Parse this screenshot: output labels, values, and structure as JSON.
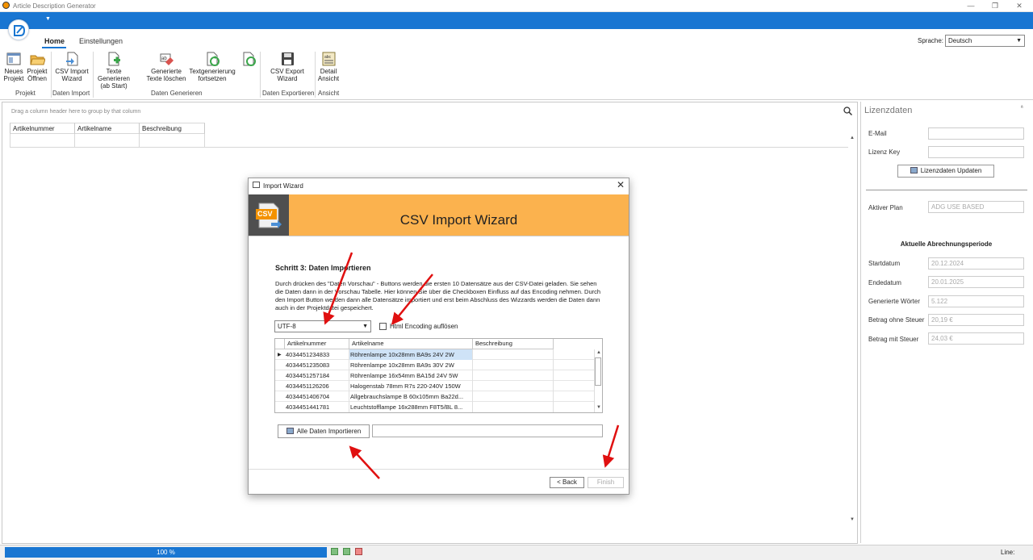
{
  "window": {
    "title": "Article Description Generator"
  },
  "ribbon": {
    "tabs": [
      "Home",
      "Einstellungen"
    ],
    "language_label": "Sprache:",
    "language_value": "Deutsch",
    "buttons": {
      "new_project": [
        "Neues",
        "Projekt"
      ],
      "open_project": [
        "Projekt",
        "Öffnen"
      ],
      "csv_import": [
        "CSV Import",
        "Wizard"
      ],
      "generate_texts": [
        "Texte Generieren",
        "(ab Start)"
      ],
      "delete_texts": [
        "Generierte",
        "Texte löschen"
      ],
      "continue_generation": [
        "Textgenerierung",
        "fortsetzen"
      ],
      "csv_export": [
        "CSV Export",
        "Wizard"
      ],
      "detail_view": [
        "Detail",
        "Ansicht"
      ]
    },
    "groups": [
      "Projekt",
      "Daten Import",
      "Daten Generieren",
      "Daten Exportieren",
      "Ansicht"
    ]
  },
  "grid": {
    "group_hint": "Drag a column header here to group by that column",
    "columns": [
      "Artikelnummer",
      "Artikelname",
      "Beschreibung"
    ]
  },
  "license_panel": {
    "title": "Lizenzdaten",
    "pin_symbol": "ª",
    "email_label": "E-Mail",
    "license_key_label": "Lizenz Key",
    "update_button": "Lizenzdaten Updaten",
    "plan_label": "Aktiver Plan",
    "plan_value": "ADG USE BASED",
    "billing_heading": "Aktuelle Abrechnungsperiode",
    "fields": [
      {
        "label": "Startdatum",
        "value": "20.12.2024"
      },
      {
        "label": "Endedatum",
        "value": "20.01.2025"
      },
      {
        "label": "Generierte Wörter",
        "value": "5.122"
      },
      {
        "label": "Betrag ohne Steuer",
        "value": "20,19 €"
      },
      {
        "label": "Betrag mit Steuer",
        "value": "24,03 €"
      }
    ]
  },
  "status": {
    "progress_label": "100 %",
    "progress_fraction": 1.0,
    "line_label": "Line:"
  },
  "dialog": {
    "title": "Import Wizard",
    "close_symbol": "✕",
    "banner_badge": "CSV",
    "banner_title": "CSV Import Wizard",
    "step_title": "Schritt 3: Daten Importieren",
    "step_description": "Durch drücken des \"Daten Vorschau\" - Buttons werden die ersten 10 Datensätze aus der CSV-Datei geladen. Sie sehen die Daten dann in der Vorschau Tabelle. Hier können Sie über die Checkboxen Einfluss auf das Encoding nehmen. Durch den Import Button werden dann alle Datensätze importiert und erst beim Abschluss des Wizzards werden die Daten dann auch in der Projektdatei gespeichert.",
    "encoding_value": "UTF-8",
    "html_checkbox_label": "Html Encoding auflösen",
    "preview_columns": [
      "Artikelnummer",
      "Artikelname",
      "Beschreibung"
    ],
    "preview_rows": [
      {
        "nr": "4034451234833",
        "name": "Röhrenlampe 10x28mm BA9s 24V 2W"
      },
      {
        "nr": "4034451235083",
        "name": "Röhrenlampe 10x28mm BA9s 30V 2W"
      },
      {
        "nr": "4034451257184",
        "name": "Röhrenlampe 16x54mm BA15d 24V 5W"
      },
      {
        "nr": "4034451126206",
        "name": "Halogenstab  78mm R7s 220-240V 150W"
      },
      {
        "nr": "4034451406704",
        "name": "Allgebrauchslampe B 60x105mm Ba22d..."
      },
      {
        "nr": "4034451441781",
        "name": "Leuchtstofflampe 16x288mm F8T5/BL 8..."
      }
    ],
    "import_button": "Alle Daten Importieren",
    "back_button": "< Back",
    "finish_button": "Finish"
  },
  "colors": {
    "accent": "#1976d2",
    "banner": "#fbb24e",
    "annotation_arrow": "#e01010"
  }
}
